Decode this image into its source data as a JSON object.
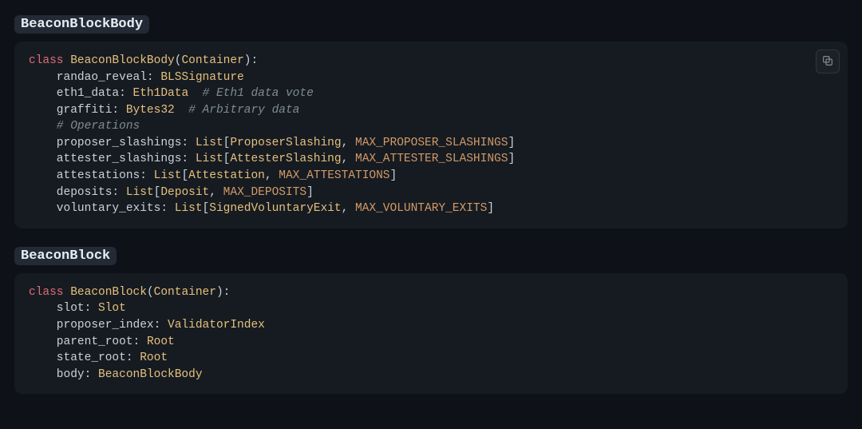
{
  "sections": [
    {
      "heading": "BeaconBlockBody",
      "code_tokens": [
        [
          {
            "t": "class ",
            "c": "kw"
          },
          {
            "t": "BeaconBlockBody",
            "c": "cls"
          },
          {
            "t": "(",
            "c": "punct"
          },
          {
            "t": "Container",
            "c": "cls"
          },
          {
            "t": "):",
            "c": "punct"
          }
        ],
        [
          {
            "t": "    randao_reveal: ",
            "c": "plain"
          },
          {
            "t": "BLSSignature",
            "c": "cls"
          }
        ],
        [
          {
            "t": "    eth1_data: ",
            "c": "plain"
          },
          {
            "t": "Eth1Data",
            "c": "cls"
          },
          {
            "t": "  # Eth1 data vote",
            "c": "com"
          }
        ],
        [
          {
            "t": "    graffiti: ",
            "c": "plain"
          },
          {
            "t": "Bytes32",
            "c": "cls"
          },
          {
            "t": "  # Arbitrary data",
            "c": "com"
          }
        ],
        [
          {
            "t": "    # Operations",
            "c": "com"
          }
        ],
        [
          {
            "t": "    proposer_slashings: ",
            "c": "plain"
          },
          {
            "t": "List",
            "c": "cls"
          },
          {
            "t": "[",
            "c": "punct"
          },
          {
            "t": "ProposerSlashing",
            "c": "cls"
          },
          {
            "t": ", ",
            "c": "punct"
          },
          {
            "t": "MAX_PROPOSER_SLASHINGS",
            "c": "const"
          },
          {
            "t": "]",
            "c": "punct"
          }
        ],
        [
          {
            "t": "    attester_slashings: ",
            "c": "plain"
          },
          {
            "t": "List",
            "c": "cls"
          },
          {
            "t": "[",
            "c": "punct"
          },
          {
            "t": "AttesterSlashing",
            "c": "cls"
          },
          {
            "t": ", ",
            "c": "punct"
          },
          {
            "t": "MAX_ATTESTER_SLASHINGS",
            "c": "const"
          },
          {
            "t": "]",
            "c": "punct"
          }
        ],
        [
          {
            "t": "    attestations: ",
            "c": "plain"
          },
          {
            "t": "List",
            "c": "cls"
          },
          {
            "t": "[",
            "c": "punct"
          },
          {
            "t": "Attestation",
            "c": "cls"
          },
          {
            "t": ", ",
            "c": "punct"
          },
          {
            "t": "MAX_ATTESTATIONS",
            "c": "const"
          },
          {
            "t": "]",
            "c": "punct"
          }
        ],
        [
          {
            "t": "    deposits: ",
            "c": "plain"
          },
          {
            "t": "List",
            "c": "cls"
          },
          {
            "t": "[",
            "c": "punct"
          },
          {
            "t": "Deposit",
            "c": "cls"
          },
          {
            "t": ", ",
            "c": "punct"
          },
          {
            "t": "MAX_DEPOSITS",
            "c": "const"
          },
          {
            "t": "]",
            "c": "punct"
          }
        ],
        [
          {
            "t": "    voluntary_exits: ",
            "c": "plain"
          },
          {
            "t": "List",
            "c": "cls"
          },
          {
            "t": "[",
            "c": "punct"
          },
          {
            "t": "SignedVoluntaryExit",
            "c": "cls"
          },
          {
            "t": ", ",
            "c": "punct"
          },
          {
            "t": "MAX_VOLUNTARY_EXITS",
            "c": "const"
          },
          {
            "t": "]",
            "c": "punct"
          }
        ]
      ],
      "show_copy": true
    },
    {
      "heading": "BeaconBlock",
      "code_tokens": [
        [
          {
            "t": "class ",
            "c": "kw"
          },
          {
            "t": "BeaconBlock",
            "c": "cls"
          },
          {
            "t": "(",
            "c": "punct"
          },
          {
            "t": "Container",
            "c": "cls"
          },
          {
            "t": "):",
            "c": "punct"
          }
        ],
        [
          {
            "t": "    slot: ",
            "c": "plain"
          },
          {
            "t": "Slot",
            "c": "cls"
          }
        ],
        [
          {
            "t": "    proposer_index: ",
            "c": "plain"
          },
          {
            "t": "ValidatorIndex",
            "c": "cls"
          }
        ],
        [
          {
            "t": "    parent_root: ",
            "c": "plain"
          },
          {
            "t": "Root",
            "c": "cls"
          }
        ],
        [
          {
            "t": "    state_root: ",
            "c": "plain"
          },
          {
            "t": "Root",
            "c": "cls"
          }
        ],
        [
          {
            "t": "    body: ",
            "c": "plain"
          },
          {
            "t": "BeaconBlockBody",
            "c": "cls"
          }
        ]
      ],
      "show_copy": false
    }
  ]
}
